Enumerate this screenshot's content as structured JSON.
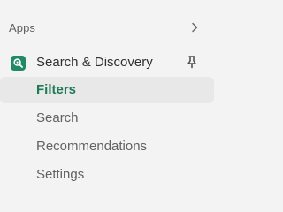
{
  "nav": {
    "section_label": "Apps",
    "app": {
      "name": "Search & Discovery",
      "icon": "search-discovery-app-icon",
      "accent_color": "#1f8a63",
      "pinned": true
    },
    "items": [
      {
        "label": "Filters",
        "active": true
      },
      {
        "label": "Search",
        "active": false
      },
      {
        "label": "Recommendations",
        "active": false
      },
      {
        "label": "Settings",
        "active": false
      }
    ]
  }
}
